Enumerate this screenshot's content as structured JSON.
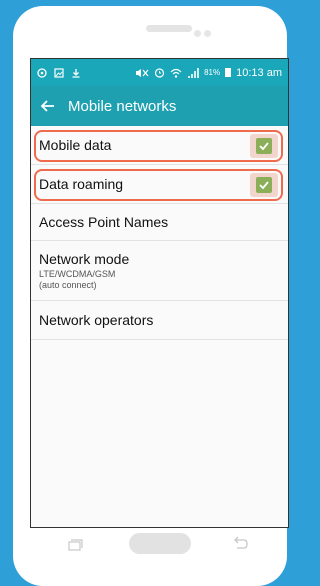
{
  "status_bar": {
    "icons_left": [
      "whatsapp-icon",
      "image-icon",
      "download-icon"
    ],
    "icons_right": [
      "mute-icon",
      "alarm-icon",
      "wifi-icon",
      "signal-icon"
    ],
    "battery": "81%",
    "time": "10:13 am"
  },
  "app_bar": {
    "title": "Mobile networks"
  },
  "settings": [
    {
      "label": "Mobile data",
      "checked": true,
      "highlighted": true
    },
    {
      "label": "Data roaming",
      "checked": true,
      "highlighted": true
    },
    {
      "label": "Access Point Names"
    },
    {
      "label": "Network mode",
      "sub1": "LTE/WCDMA/GSM",
      "sub2": "(auto connect)"
    },
    {
      "label": "Network operators"
    }
  ],
  "colors": {
    "background": "#2f9fd7",
    "app_bar": "#1ea0b1",
    "highlight_border": "#ef6b4d",
    "checkbox": "#8aaf58"
  }
}
